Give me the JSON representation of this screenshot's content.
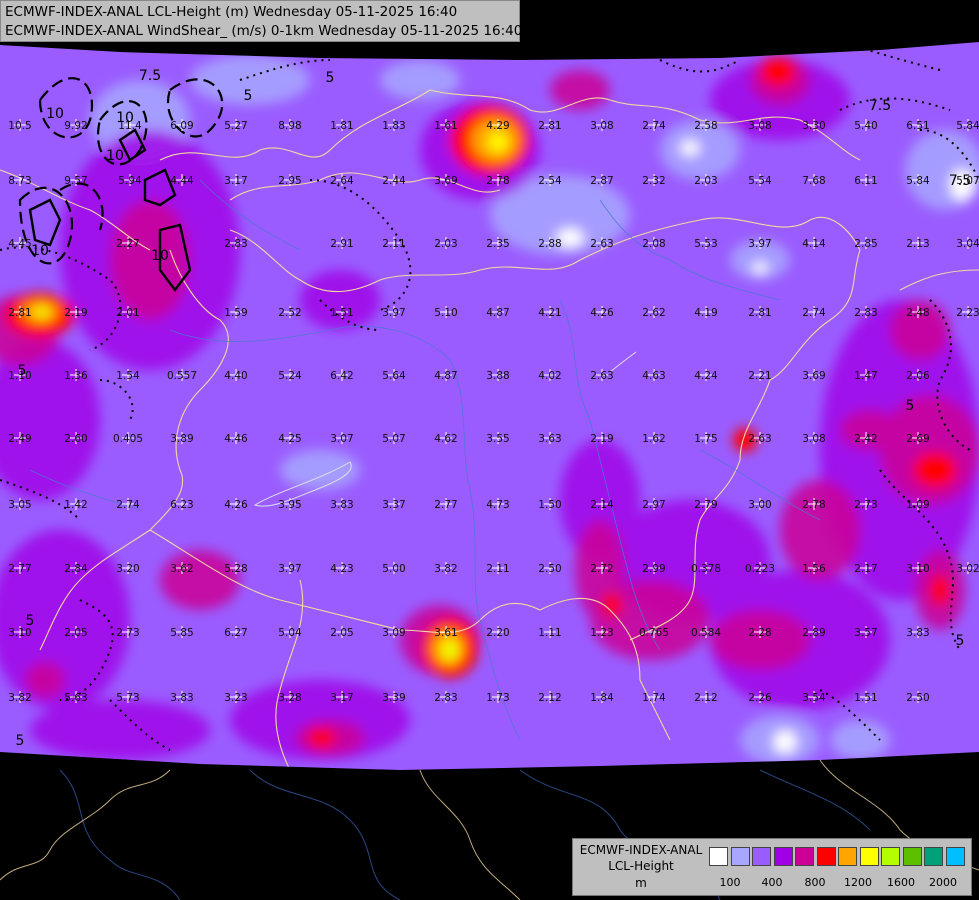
{
  "header": {
    "line1": "ECMWF-INDEX-ANAL LCL-Height (m) Wednesday 05-11-2025 16:40",
    "line2": "ECMWF-INDEX-ANAL WindShear_ (m/s) 0-1km Wednesday 05-11-2025 16:40"
  },
  "legend": {
    "title_line1": "ECMWF-INDEX-ANAL",
    "title_line2": "LCL-Height",
    "title_line3": "m",
    "colors": [
      "#ffffff",
      "#a7a7ff",
      "#9a5cff",
      "#a000e6",
      "#cc0096",
      "#ff0000",
      "#ffa500",
      "#ffff00",
      "#b3ff00",
      "#5cbf00",
      "#00a07a",
      "#00bfff"
    ],
    "ticks": [
      "100",
      "400",
      "800",
      "1200",
      "1600",
      "2000"
    ]
  },
  "contour_labels": [
    "10",
    "10",
    "7.5",
    "5",
    "5",
    "7.5",
    "10",
    "10",
    "10",
    "7.5",
    "5",
    "5",
    "5",
    "5",
    "5"
  ],
  "stations": [
    "1.81",
    "1.83",
    "1.61",
    "4.29",
    "2.81",
    "3.08",
    "2.74",
    "2.58",
    "3.08",
    "3.30",
    "5.40",
    "6.51",
    "5.84",
    "10.5",
    "9.92",
    "11.4",
    "6.09",
    "5.27",
    "8.98",
    "8.73",
    "9.57",
    "5.94",
    "4.44",
    "3.17",
    "2.95",
    "2.64",
    "2.44",
    "3.69",
    "2.78",
    "2.54",
    "2.87",
    "2.32",
    "2.03",
    "5.54",
    "7.68",
    "6.11",
    "5.84",
    "5.07",
    "4.45",
    "2.27",
    "2.83",
    "2.91",
    "2.11",
    "2.03",
    "2.35",
    "2.88",
    "2.63",
    "2.08",
    "5.53",
    "3.97",
    "4.14",
    "2.85",
    "2.13",
    "3.04",
    "2.81",
    "2.19",
    "2.01",
    "1.59",
    "2.52",
    "1.51",
    "3.97",
    "5.10",
    "4.87",
    "4.21",
    "4.26",
    "2.62",
    "4.19",
    "2.81",
    "2.74",
    "2.83",
    "2.48",
    "2.23",
    "1.10",
    "1.36",
    "1.54",
    "0.557",
    "4.40",
    "5.24",
    "6.42",
    "5.64",
    "4.87",
    "3.88",
    "4.02",
    "2.63",
    "4.63",
    "4.24",
    "2.21",
    "3.69",
    "1.47",
    "2.06",
    "2.49",
    "2.60",
    "0.405",
    "3.89",
    "4.46",
    "4.25",
    "3.07",
    "5.07",
    "4.62",
    "3.55",
    "3.63",
    "2.19",
    "1.62",
    "1.75",
    "2.63",
    "3.08",
    "2.42",
    "2.69",
    "3.05",
    "1.42",
    "2.74",
    "6.23",
    "4.26",
    "3.95",
    "3.83",
    "3.37",
    "2.77",
    "4.73",
    "1.50",
    "2.14",
    "2.97",
    "2.79",
    "3.00",
    "2.78",
    "2.73",
    "1.09",
    "2.77",
    "2.84",
    "3.20",
    "3.62",
    "5.28",
    "3.97",
    "4.23",
    "5.00",
    "3.82",
    "2.11",
    "2.50",
    "2.72",
    "2.99",
    "0.378",
    "0.223",
    "1.56",
    "2.17",
    "3.10",
    "3.02",
    "3.10",
    "2.05",
    "2.73",
    "5.85",
    "6.27",
    "5.04",
    "2.05",
    "3.09",
    "3.61",
    "2.20",
    "1.11",
    "1.23",
    "0.765",
    "0.584",
    "2.28",
    "2.89",
    "3.57",
    "3.83",
    "3.82",
    "5.63",
    "5.73",
    "3.83",
    "3.23",
    "3.28",
    "3.17",
    "3.39",
    "2.83",
    "1.73",
    "2.12",
    "1.84",
    "1.74",
    "2.12",
    "2.26",
    "3.54",
    "1.51",
    "2.50"
  ]
}
